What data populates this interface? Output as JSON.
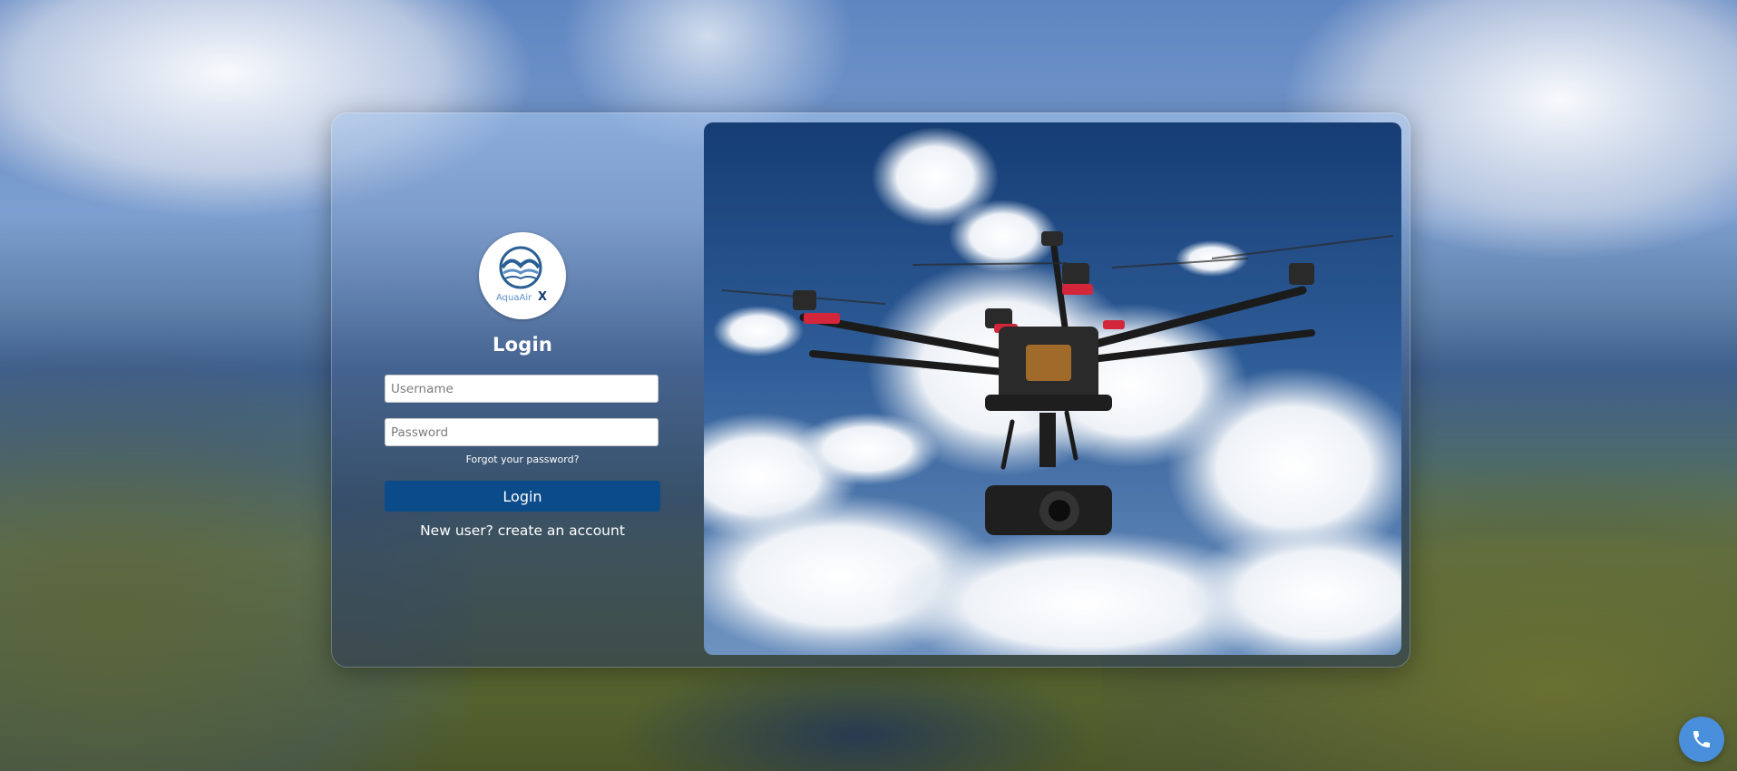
{
  "brand": {
    "logo_text": "AquaAir",
    "logo_mark": "X"
  },
  "login": {
    "title": "Login",
    "username_placeholder": "Username",
    "password_placeholder": "Password",
    "forgot_link": "Forgot your password?",
    "submit_label": "Login",
    "signup_link": "New user? create an account"
  },
  "icons": {
    "contact": "phone-icon"
  },
  "colors": {
    "login_button": "#0c4b89",
    "phone_button": "#4a8fdc",
    "logo_wave": "#2a5f96"
  }
}
